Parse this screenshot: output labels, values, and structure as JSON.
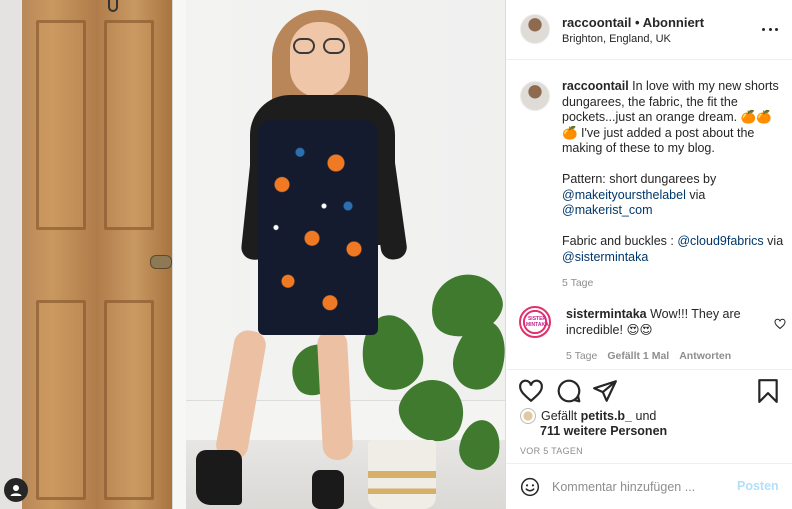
{
  "header": {
    "username": "raccoontail",
    "separator": "•",
    "follow_status": "Abonniert",
    "location": "Brighton, England, UK"
  },
  "caption": {
    "username": "raccoontail",
    "text_1": " In love with my new shorts dungarees, the fabric, the fit the pockets...just an orange dream. 🍊🍊🍊 I've just added a post about the making of these to my blog.\n\nPattern: short dungarees by ",
    "mention_1": "@makeityoursthelabel",
    "text_2": " via ",
    "mention_2": "@makerist_com",
    "text_3": "\n\nFabric and buckles : ",
    "mention_3": "@cloud9fabrics",
    "text_4": " via ",
    "mention_4": "@sistermintaka",
    "time": "5 Tage"
  },
  "reply": {
    "username": "sistermintaka",
    "avatar_logo_text": "SISTER MINTAKA",
    "text": " Wow!!! They are incredible! 😍😍",
    "time": "5 Tage",
    "likes": "Gefällt 1 Mal",
    "reply_label": "Antworten"
  },
  "likes": {
    "prefix": "Gefällt ",
    "liker": "petits.b_",
    "suffix": " und",
    "others": "711 weitere Personen"
  },
  "post_date": "VOR 5 TAGEN",
  "comment_box": {
    "placeholder": "Kommentar hinzufügen ...",
    "post_label": "Posten"
  },
  "colors": {
    "text": "#262626",
    "muted": "#8e8e8e",
    "mention": "#00376b",
    "post_button_disabled": "#b2dffc",
    "border": "#dbdbdb"
  },
  "icons": [
    "more-icon",
    "heart-icon",
    "comment-icon",
    "share-icon",
    "bookmark-icon",
    "emoji-icon",
    "account-badge-icon"
  ]
}
